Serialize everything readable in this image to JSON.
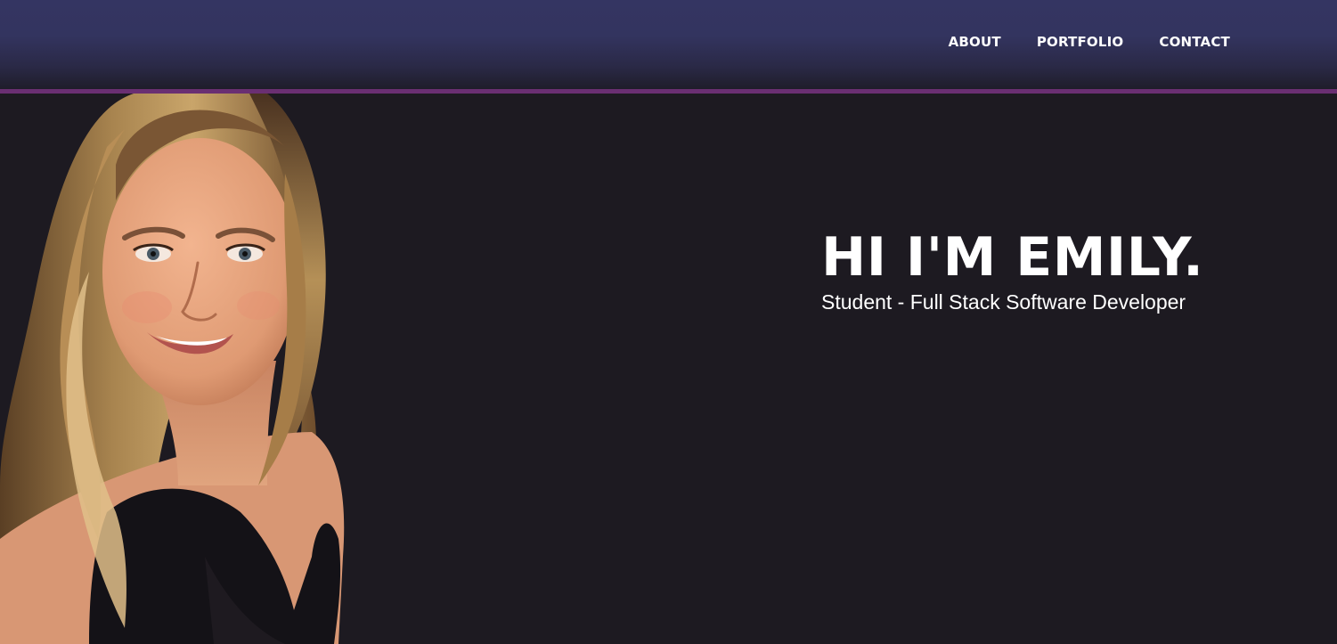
{
  "nav": {
    "items": [
      {
        "label": "ABOUT"
      },
      {
        "label": "PORTFOLIO"
      },
      {
        "label": "CONTACT"
      }
    ]
  },
  "hero": {
    "title": "HI I'M EMILY.",
    "subtitle": "Student - Full Stack Software Developer"
  },
  "colors": {
    "nav_background": "#343562",
    "nav_accent": "#6a2f72",
    "page_background": "#1d1a21",
    "text": "#ffffff"
  }
}
